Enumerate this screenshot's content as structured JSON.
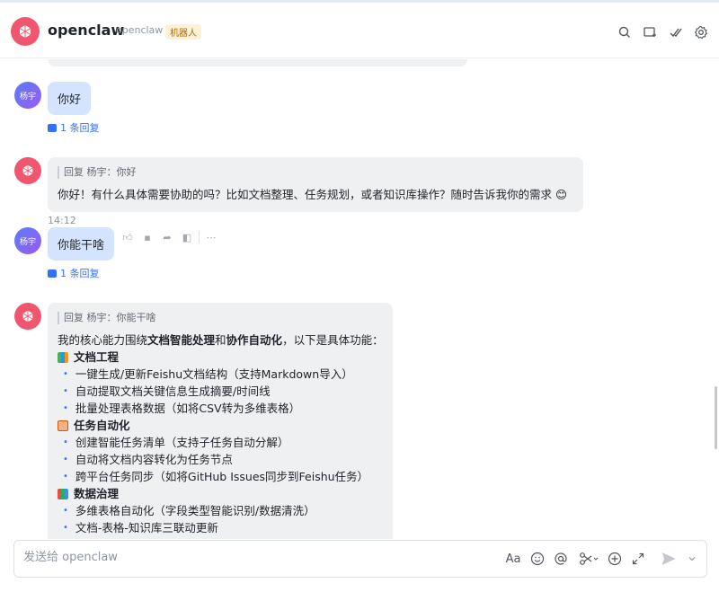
{
  "header": {
    "title": "openclaw",
    "subtitle": "openclaw",
    "badge": "机器人",
    "icons": [
      "search-icon",
      "add-tab-icon",
      "check-icon",
      "settings-icon"
    ]
  },
  "messages": {
    "m1": {
      "avatar": "杨宇",
      "text": "你好",
      "replies": "1 条回复"
    },
    "m2": {
      "quote": "回复 杨宇：你好",
      "text": "你好！有什么具体需要协助的吗？比如文档整理、任务规划，或者知识库操作？随时告诉我你的需求 😊"
    },
    "time": "14:12",
    "m3": {
      "avatar": "杨宇",
      "text": "你能干啥",
      "replies": "1 条回复"
    },
    "m4": {
      "quote": "回复 杨宇：你能干啥",
      "intro_a": "我的核心能力围绕",
      "intro_b": "文档智能处理",
      "intro_c": "和",
      "intro_d": "协作自动化",
      "intro_e": "，以下是具体功能：",
      "sections": [
        {
          "title": "文档工程",
          "items": [
            "一键生成/更新Feishu文档结构（支持Markdown导入）",
            "自动提取文档关键信息生成摘要/时间线",
            "批量处理表格数据（如将CSV转为多维表格）"
          ]
        },
        {
          "title": "任务自动化",
          "items": [
            "创建智能任务清单（支持子任务自动分解）",
            "自动将文档内容转化为任务节点",
            "跨平台任务同步（如将GitHub Issues同步到Feishu任务）"
          ]
        },
        {
          "title": "数据治理",
          "items": [
            "多维表格自动化（字段类型智能识别/数据清洗）",
            "文档-表格-知识库三联动更新"
          ]
        }
      ]
    }
  },
  "composer": {
    "placeholder": "发送给 openclaw",
    "font_label": "Aa"
  },
  "colors": {
    "accent": "#3370ff",
    "brand": "#f0566e",
    "user_bubble": "#d4e4ff",
    "bot_bubble": "#eff0f1"
  }
}
